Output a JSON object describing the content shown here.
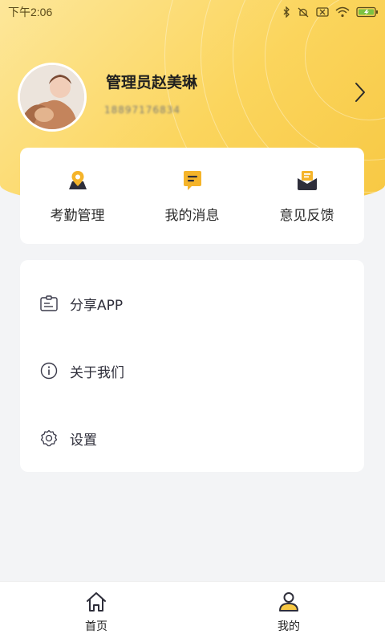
{
  "status_bar": {
    "time": "下午2:06",
    "icons": [
      "bluetooth-icon",
      "alarm-off-icon",
      "sim-off-icon",
      "wifi-icon",
      "battery-charging-icon"
    ]
  },
  "profile": {
    "name": "管理员赵美琳",
    "phone": "18897176834",
    "avatar_icon": "avatar-photo"
  },
  "quick_actions": [
    {
      "label": "考勤管理",
      "icon": "location-pin-icon"
    },
    {
      "label": "我的消息",
      "icon": "message-icon"
    },
    {
      "label": "意见反馈",
      "icon": "feedback-envelope-icon"
    }
  ],
  "menu": [
    {
      "label": "分享APP",
      "icon": "share-card-icon"
    },
    {
      "label": "关于我们",
      "icon": "info-icon"
    },
    {
      "label": "设置",
      "icon": "gear-icon"
    }
  ],
  "tabbar": {
    "tabs": [
      {
        "label": "首页",
        "icon": "home-icon",
        "active": false
      },
      {
        "label": "我的",
        "icon": "user-icon",
        "active": true
      }
    ]
  },
  "colors": {
    "accent": "#f7c843",
    "accent_light": "#fde79a",
    "icon_dark": "#2e2e3a",
    "background": "#f3f4f6"
  }
}
